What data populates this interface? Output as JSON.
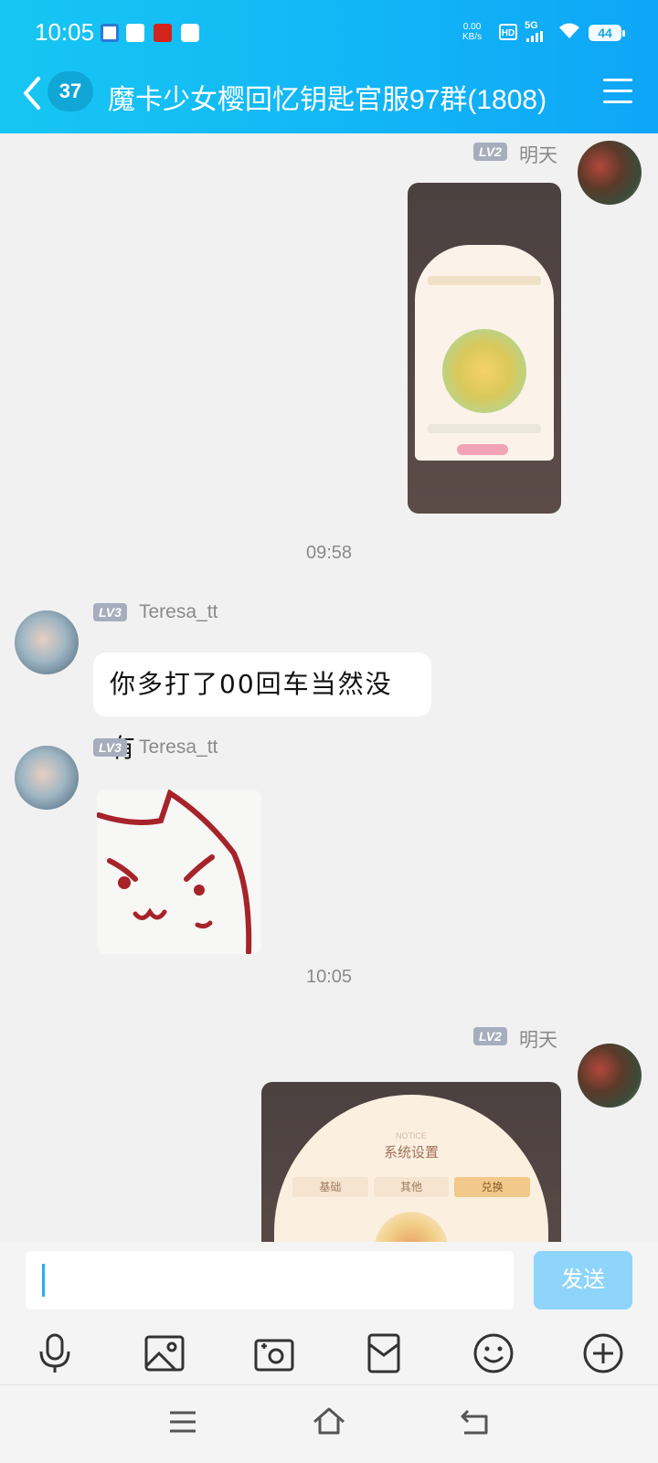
{
  "status_bar": {
    "time": "10:05",
    "net_speed": "0.00",
    "net_unit": "KB/s",
    "hd": "HD",
    "network": "5G",
    "battery": "44"
  },
  "header": {
    "unread_count": "37",
    "title": "魔卡少女樱回忆钥匙官服97群(1808)"
  },
  "messages": [
    {
      "type": "image",
      "side": "right",
      "level": "LV2",
      "sender": "明天"
    },
    {
      "type": "time",
      "text": "09:58"
    },
    {
      "type": "text",
      "side": "left",
      "level": "LV3",
      "sender": "Teresa_tt",
      "text": "你多打了00回车当然没有"
    },
    {
      "type": "sticker",
      "side": "left",
      "level": "LV3",
      "sender": "Teresa_tt"
    },
    {
      "type": "time",
      "text": "10:05"
    },
    {
      "type": "image",
      "side": "right",
      "level": "LV2",
      "sender": "明天",
      "notice": "NOTICE",
      "panel_title": "系统设置",
      "tabs": [
        "基础",
        "其他",
        "兑换"
      ]
    }
  ],
  "input": {
    "send_label": "发送"
  },
  "toolbar": [
    "microphone-icon",
    "image-icon",
    "camera-icon",
    "red-packet-icon",
    "emoji-icon",
    "plus-icon"
  ],
  "colors": {
    "header_start": "#17c6f2",
    "header_end": "#0ea6f7",
    "send_button": "#8fd5fb",
    "caret": "#1db2f5"
  }
}
